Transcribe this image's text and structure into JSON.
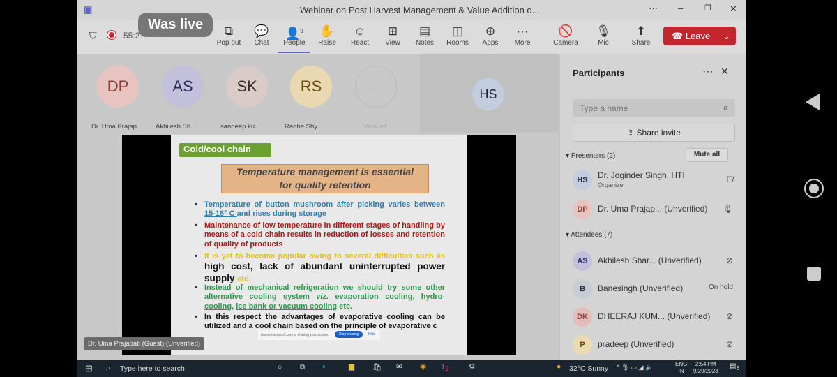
{
  "window": {
    "title": "Webinar on Post Harvest Management & Value Addition o...",
    "live_badge": "Was live",
    "timer": "55:27"
  },
  "toolbar": {
    "items": [
      {
        "label": "Pop out",
        "icon": "pop-out-icon"
      },
      {
        "label": "Chat",
        "icon": "chat-icon"
      },
      {
        "label": "People",
        "icon": "people-icon",
        "count": "9"
      },
      {
        "label": "Raise",
        "icon": "hand-icon"
      },
      {
        "label": "React",
        "icon": "smile-icon"
      },
      {
        "label": "View",
        "icon": "grid-icon"
      },
      {
        "label": "Notes",
        "icon": "notes-icon"
      },
      {
        "label": "Rooms",
        "icon": "rooms-icon"
      },
      {
        "label": "Apps",
        "icon": "plus-icon"
      },
      {
        "label": "More",
        "icon": "more-icon"
      }
    ],
    "camera": "Camera",
    "mic": "Mic",
    "share": "Share",
    "leave": "Leave"
  },
  "stage": {
    "tiles": [
      {
        "initials": "DP",
        "name": "Dr. Uma Prajap...",
        "color": "#e8c4c0"
      },
      {
        "initials": "AS",
        "name": "Akhilesh Sh...",
        "color": "#c3c0dc"
      },
      {
        "initials": "SK",
        "name": "sandeep ku...",
        "color": "#d8cbc8"
      },
      {
        "initials": "RS",
        "name": "Radhe Shy...",
        "color": "#ead9b0"
      }
    ],
    "view_all": "View all",
    "featured": "HS",
    "presenter_label": "Dr. Uma Prajapati (Guest) (Unverified)"
  },
  "slide": {
    "heading": "Cold/cool chain",
    "box": "Temperature management is essential for quality retention",
    "b1a": "Temperature of button mushroom after picking varies between ",
    "b1u": "15-18° C ",
    "b1b": "and rises during storage",
    "b2": "Maintenance of low temperature in different stages of handling by means of a cold chain results in reduction of losses and retention of quality of products",
    "b3a": "It is yet to become popular owing to several difficulties such as ",
    "b3b": "high cost, lack of abundant uninterrupted power supply ",
    "b3c": "etc.",
    "b4a": "Instead of mechanical refrigeration we should try some other alternative cooling system ",
    "b4v": "viz.",
    "b4u1": "evaporation cooling",
    "b4u2": "hydro-cooling",
    "b4u3": "ice bank or vacuum cooling",
    "b4e": " etc.",
    "b5": "In this respect the advantages of evaporative cooling can be utilized and a cool chain based on the principle of evaporative c",
    "share_bar": "teams.microsoft.com is sharing your screen.",
    "stop_sharing": "Stop sharing",
    "hide": "Hide"
  },
  "panel": {
    "title": "Participants",
    "search_placeholder": "Type a name",
    "share_invite": "Share invite",
    "presenters": "Presenters (2)",
    "mute_all": "Mute all",
    "attendees": "Attendees (7)",
    "people": [
      {
        "initials": "HS",
        "name": "Dr. Joginder Singh, HTI",
        "role": "Organizer",
        "color": "#c2cde0",
        "status": "mic-off-icon"
      },
      {
        "initials": "DP",
        "name": "Dr. Uma Prajap... (Unverified)",
        "color": "#e8c4c0",
        "status": "mic-icon"
      },
      {
        "initials": "AS",
        "name": "Akhilesh Shar...   (Unverified)",
        "color": "#c3c0dc",
        "status": "mic-blocked-icon"
      },
      {
        "initials": "B",
        "name": "Banesingh (Unverified)",
        "color": "#c6ccd2",
        "status_text": "On hold"
      },
      {
        "initials": "DK",
        "name": "DHEERAJ KUM...  (Unverified)",
        "color": "#e3bcbc",
        "status": "mic-blocked-icon"
      },
      {
        "initials": "P",
        "name": "pradeep (Unverified)",
        "color": "#eadcb0",
        "status": "mic-blocked-icon"
      }
    ]
  },
  "taskbar": {
    "search": "Type here to search",
    "weather": "32°C  Sunny",
    "lang1": "ENG",
    "lang2": "IN",
    "time": "2:54 PM",
    "date": "9/29/2023",
    "notif": "6",
    "teams_badge": "2"
  },
  "colors": {
    "leave": "#c4262e",
    "accent": "#5b5fc7",
    "slide_green": "#6aa131"
  }
}
